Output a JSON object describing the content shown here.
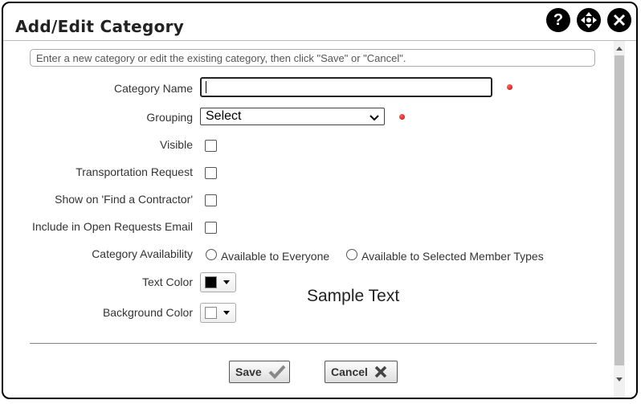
{
  "dialog": {
    "title": "Add/Edit Category",
    "help_glyph": "?"
  },
  "info_text": "Enter a new category or edit the existing category, then click \"Save\" or \"Cancel\".",
  "fields": {
    "category_name_label": "Category Name",
    "category_name_value": "",
    "grouping_label": "Grouping",
    "grouping_value": "Select",
    "visible_label": "Visible",
    "transportation_label": "Transportation Request",
    "find_contractor_label": "Show on 'Find a Contractor'",
    "open_requests_label": "Include in Open Requests Email",
    "availability_label": "Category Availability",
    "availability_options": [
      "Available to Everyone",
      "Available to Selected Member Types"
    ],
    "text_color_label": "Text Color",
    "text_color_value": "#000000",
    "background_color_label": "Background Color",
    "background_color_value": "#ffffff",
    "sample_text": "Sample Text"
  },
  "buttons": {
    "save_label": "Save",
    "cancel_label": "Cancel"
  },
  "colors": {
    "required_marker": "#cc0000"
  }
}
